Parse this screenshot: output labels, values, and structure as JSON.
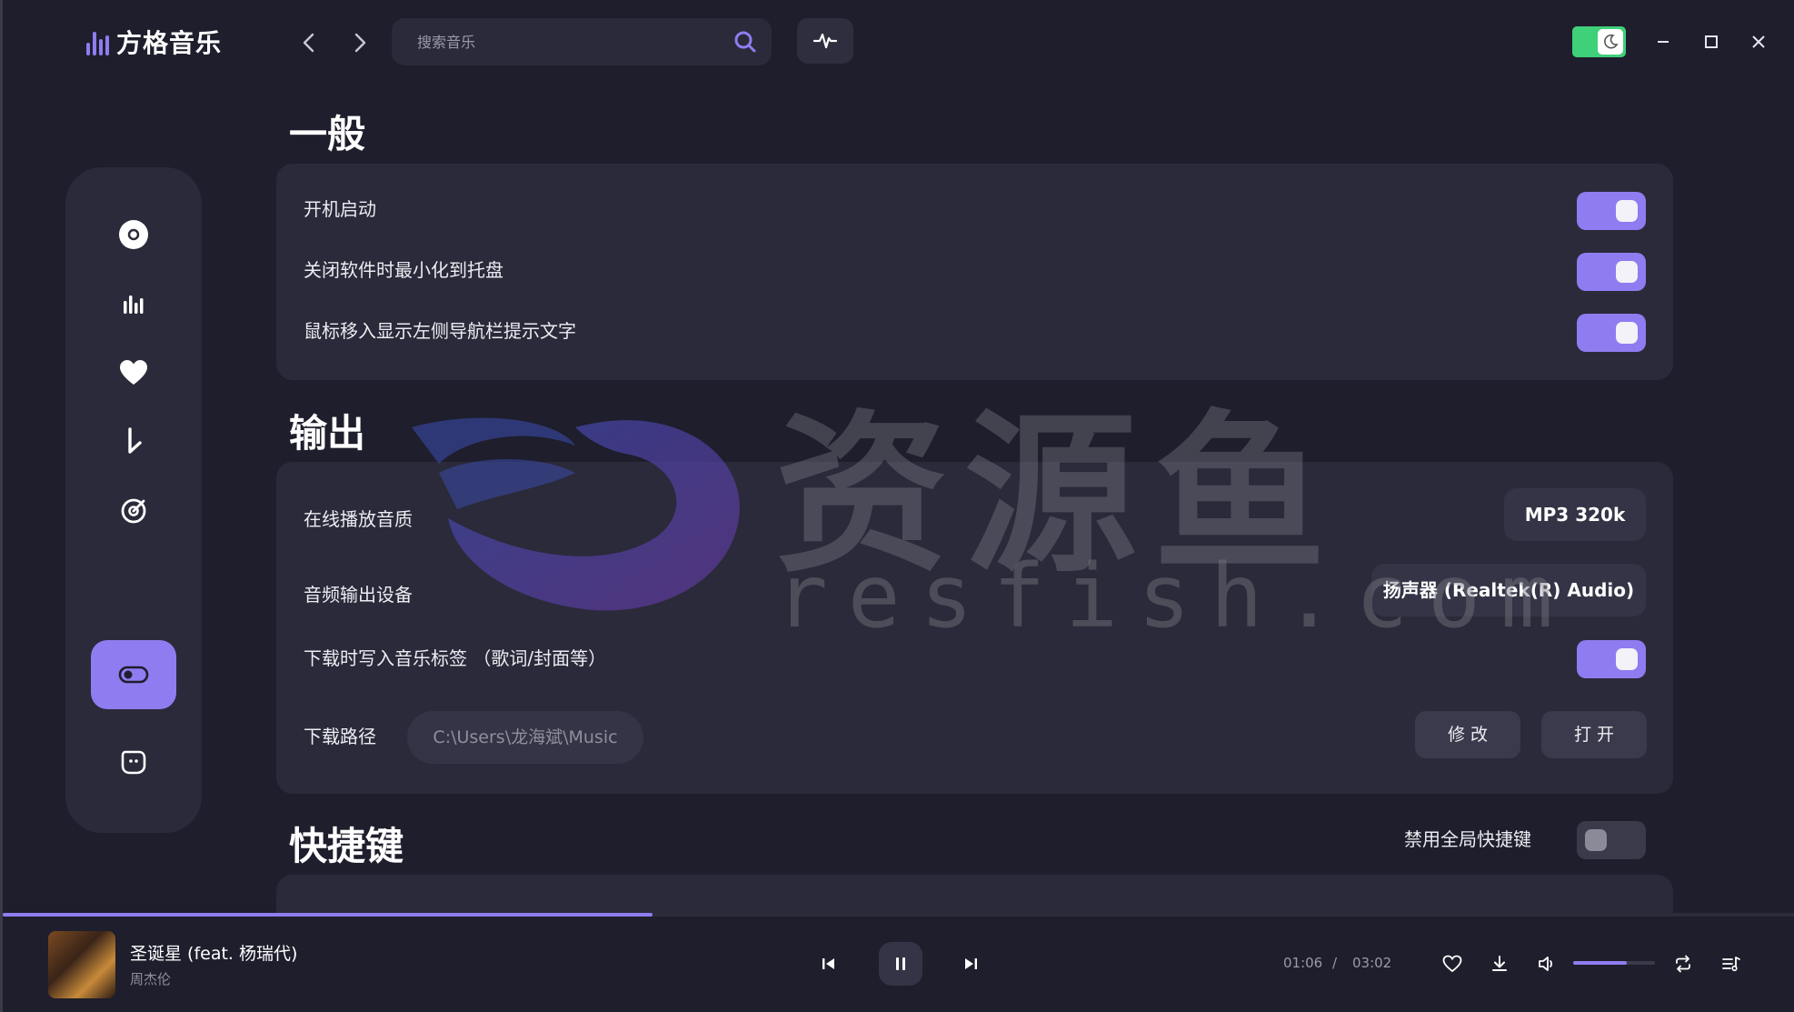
{
  "app": {
    "title": "方格音乐",
    "search_placeholder": "搜索音乐"
  },
  "sidebar": {
    "items": [
      {
        "name": "disc-icon"
      },
      {
        "name": "chart-bars-icon"
      },
      {
        "name": "heart-icon"
      },
      {
        "name": "download-arrow-icon"
      },
      {
        "name": "radar-icon"
      },
      {
        "name": "settings-toggle-icon",
        "active": true
      },
      {
        "name": "face-icon"
      }
    ]
  },
  "general": {
    "title": "一般",
    "rows": [
      {
        "label": "开机启动",
        "on": true
      },
      {
        "label": "关闭软件时最小化到托盘",
        "on": true
      },
      {
        "label": "鼠标移入显示左侧导航栏提示文字",
        "on": true
      }
    ]
  },
  "output": {
    "title": "输出",
    "quality_label": "在线播放音质",
    "quality_value": "MP3 320k",
    "device_label": "音频输出设备",
    "device_value": "扬声器 (Realtek(R) Audio)",
    "tags_label": "下载时写入音乐标签 （歌词/封面等）",
    "tags_on": true,
    "path_label": "下载路径",
    "path_value": "C:\\Users\\龙海斌\\Music",
    "modify_label": "修 改",
    "open_label": "打 开"
  },
  "shortcuts": {
    "title": "快捷键",
    "disable_label": "禁用全局快捷键",
    "disable_on": false
  },
  "watermark": {
    "text": "资源鱼",
    "url": "resfish.com"
  },
  "player": {
    "song_title": "圣诞星 (feat. 杨瑞代)",
    "artist": "周杰伦",
    "current_time": "01:06",
    "separator": "/",
    "total_time": "03:02",
    "progress": 0.362,
    "volume": 0.65
  },
  "colors": {
    "accent": "#8f7cf0",
    "background": "#1e1e2c",
    "card": "#2a2a3a",
    "theme_toggle": "#3fd07a"
  }
}
